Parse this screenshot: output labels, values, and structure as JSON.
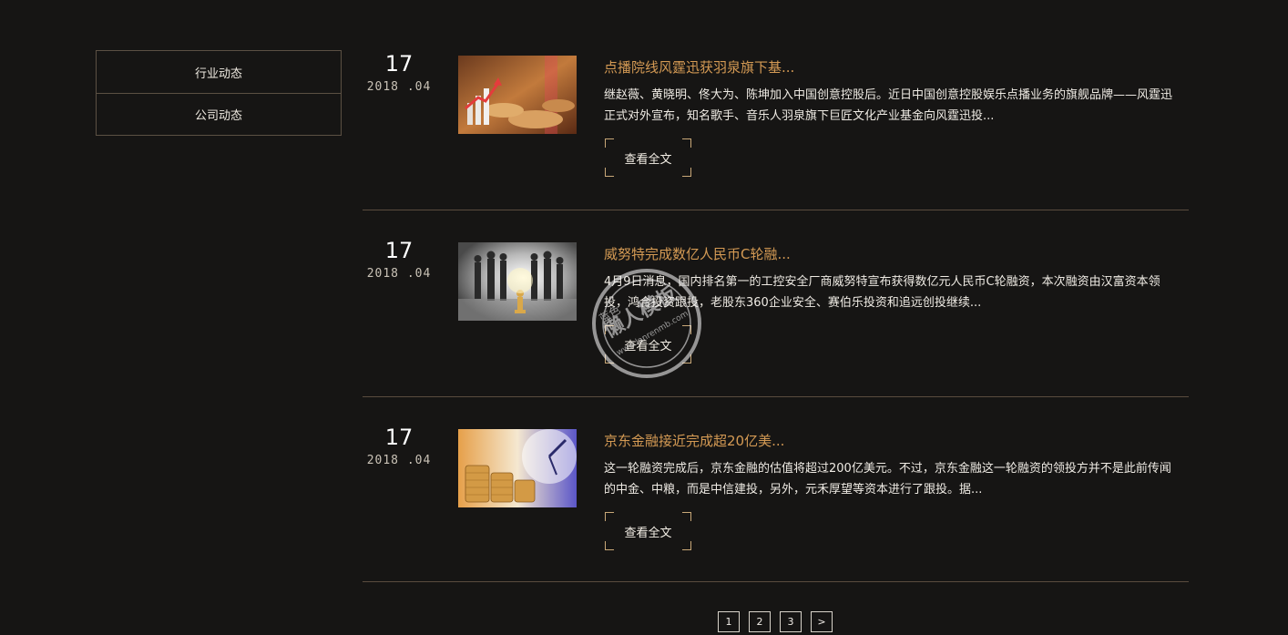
{
  "sidebar": {
    "items": [
      {
        "label": "行业动态"
      },
      {
        "label": "公司动态"
      }
    ]
  },
  "news": [
    {
      "day": "17",
      "year_month": "2018 .04",
      "title": "点播院线风霆迅获羽泉旗下基...",
      "desc": "继赵薇、黄晓明、佟大为、陈坤加入中国创意控股后。近日中国创意控股娱乐点播业务的旗舰品牌——风霆迅正式对外宣布，知名歌手、音乐人羽泉旗下巨匠文化产业基金向风霆迅投...",
      "more": "查看全文",
      "image": "coins-chart-image"
    },
    {
      "day": "17",
      "year_month": "2018 .04",
      "title": "威努特完成数亿人民币C轮融...",
      "desc": "4月9日消息，国内排名第一的工控安全厂商威努特宣布获得数亿元人民币C轮融资，本次融资由汉富资本领投，鸿合投资跟投，老股东360企业安全、赛伯乐投资和追远创投继续...",
      "more": "查看全文",
      "image": "business-people-chess-image"
    },
    {
      "day": "17",
      "year_month": "2018 .04",
      "title": "京东金融接近完成超20亿美...",
      "desc": "这一轮融资完成后，京东金融的估值将超过200亿美元。不过，京东金融这一轮融资的领投方并不是此前传闻的中金、中粮，而是中信建投，另外，元禾厚望等资本进行了跟投。据...",
      "more": "查看全文",
      "image": "coins-clock-image"
    }
  ],
  "pagination": {
    "pages": [
      "1",
      "2",
      "3"
    ],
    "next": ">"
  },
  "watermark": {
    "line1": "懒人模板",
    "line2": "蓝色",
    "url": "www.lanrenmb.com"
  },
  "colors": {
    "background": "#161514",
    "title_accent": "#d49a54",
    "border": "#5b5043",
    "corner_accent": "#c9a878"
  }
}
